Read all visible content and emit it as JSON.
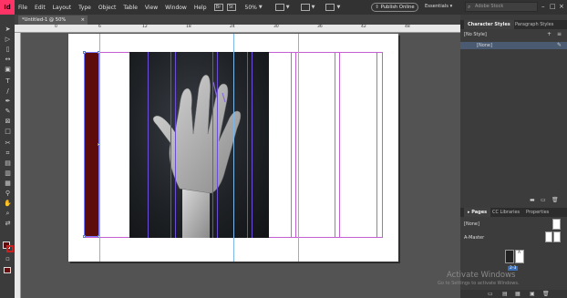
{
  "app": {
    "logo": "Id",
    "menu": [
      "File",
      "Edit",
      "Layout",
      "Type",
      "Object",
      "Table",
      "View",
      "Window",
      "Help"
    ],
    "bridge_icons": [
      "Br",
      "St"
    ],
    "zoom": "50%",
    "publish_label": "Publish Online",
    "workspace": "Essentials",
    "search_placeholder": "Adobe Stock"
  },
  "document": {
    "tab_title": "*Untitled-1 @ 50%",
    "close_symbol": "×"
  },
  "ruler": {
    "ticks": [
      "0",
      "6",
      "12",
      "18",
      "24",
      "30",
      "36",
      "42",
      "48"
    ]
  },
  "character_styles": {
    "tab_active": "Character Styles",
    "tab_other": "Paragraph Styles",
    "no_style": "[No Style]",
    "none_item": "[None]"
  },
  "pages_panel": {
    "tabs": [
      "Pages",
      "CC Libraries",
      "Properties"
    ],
    "none_label": "[None]",
    "master_label": "A-Master",
    "page_marker": "A",
    "page_badge": "2-3"
  },
  "watermark": {
    "title": "Activate Windows",
    "subtitle": "Go to Settings to activate Windows."
  },
  "colors": {
    "accent": "#ff3366",
    "bar": "#5e0b0b",
    "margin_guide": "#c35fd1",
    "column_guide": "#6a4ed8"
  }
}
